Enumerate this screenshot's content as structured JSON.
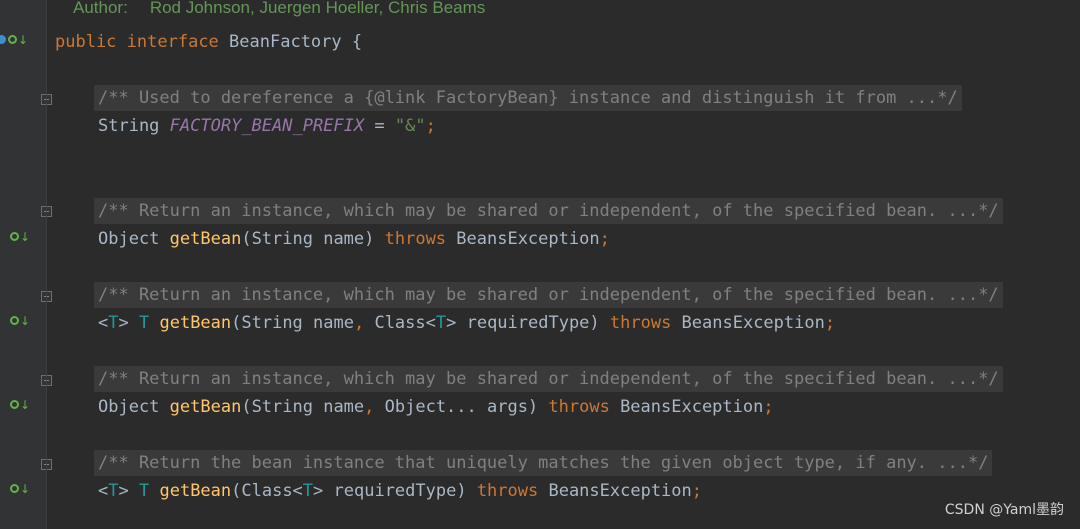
{
  "header": {
    "author_label": "Author:",
    "author_names": "Rod Johnson, Juergen Hoeller, Chris Beams"
  },
  "code": {
    "decl_public": "public",
    "decl_interface": "interface",
    "decl_name": "BeanFactory",
    "decl_brace": "{",
    "c1": "/** Used to dereference a {@link FactoryBean} instance and distinguish it from ...*/",
    "f1_type": "String",
    "f1_name": "FACTORY_BEAN_PREFIX",
    "f1_eq": " = ",
    "f1_value": "\"&\"",
    "f1_semi": ";",
    "c2": "/** Return an instance, which may be shared or independent, of the specified bean. ...*/",
    "m1_ret": "Object",
    "m1_name": "getBean",
    "m1_params": "(String name) ",
    "m1_throws": "throws",
    "m1_exc": " BeansException",
    "m1_semi": ";",
    "c3": "/** Return an instance, which may be shared or independent, of the specified bean. ...*/",
    "m2_lt": "<",
    "m2_T": "T",
    "m2_gt": "> ",
    "m2_ret": "T",
    "m2_name": "getBean",
    "m2_p1": "(String name",
    "m2_comma": ",",
    "m2_p2": " Class<",
    "m2_p2T": "T",
    "m2_p3": "> requiredType) ",
    "m2_throws": "throws",
    "m2_exc": " BeansException",
    "m2_semi": ";",
    "c4": "/** Return an instance, which may be shared or independent, of the specified bean. ...*/",
    "m3_ret": "Object",
    "m3_name": "getBean",
    "m3_p1": "(String name",
    "m3_comma": ",",
    "m3_p2": " Object... args) ",
    "m3_throws": "throws",
    "m3_exc": " BeansException",
    "m3_semi": ";",
    "c5": "/** Return the bean instance that uniquely matches the given object type, if any. ...*/",
    "m4_lt": "<",
    "m4_T": "T",
    "m4_gt": "> ",
    "m4_ret": "T",
    "m4_name": "getBean",
    "m4_p1": "(Class<",
    "m4_p1T": "T",
    "m4_p2": "> requiredType) ",
    "m4_throws": "throws",
    "m4_exc": " BeansException",
    "m4_semi": ";"
  },
  "watermark": "CSDN @Yaml墨韵",
  "colors": {
    "background": "#2b2b2b",
    "keyword": "#cc7832",
    "comment": "#808080",
    "method": "#ffc66d",
    "constant": "#9876aa",
    "string": "#6a8759",
    "type_param": "#20999d",
    "gutter_marker": "#62b543"
  },
  "icons": {
    "implementation_marker": "implemented-method-icon",
    "fold_marker": "fold-icon"
  }
}
